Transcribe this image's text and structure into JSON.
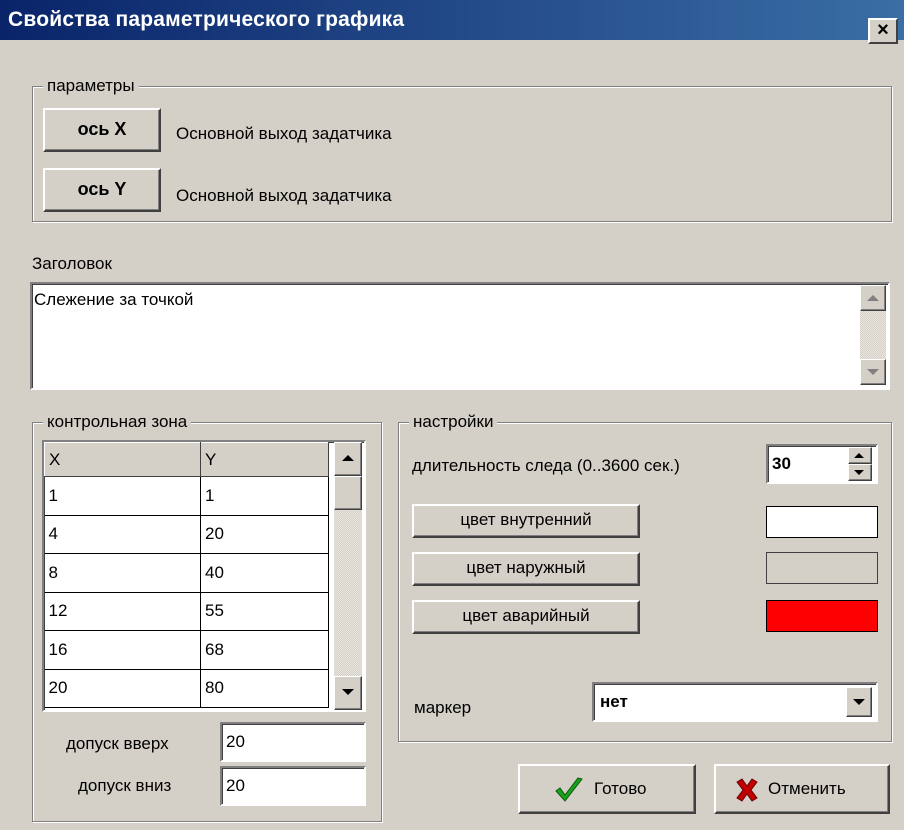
{
  "window": {
    "title": "Свойства параметрического графика",
    "close_label": "×"
  },
  "params": {
    "group_label": "параметры",
    "axis_x": {
      "button": "ось X",
      "source": "Основной выход задатчика"
    },
    "axis_y": {
      "button": "ось Y",
      "source": "Основной выход задатчика"
    }
  },
  "header": {
    "label": "Заголовок",
    "value": "Слежение за точкой"
  },
  "control_zone": {
    "group_label": "контрольная зона",
    "columns": [
      "X",
      "Y"
    ],
    "rows": [
      [
        "1",
        "1"
      ],
      [
        "4",
        "20"
      ],
      [
        "8",
        "40"
      ],
      [
        "12",
        "55"
      ],
      [
        "16",
        "68"
      ],
      [
        "20",
        "80"
      ]
    ],
    "tolerance_up": {
      "label": "допуск вверх",
      "value": "20"
    },
    "tolerance_down": {
      "label": "допуск вниз",
      "value": "20"
    }
  },
  "settings": {
    "group_label": "настройки",
    "trail": {
      "label": "длительность следа (0..3600 сек.)",
      "value": "30"
    },
    "inner_color": {
      "button": "цвет внутренний",
      "color": "#ffffff"
    },
    "outer_color": {
      "button": "цвет наружный",
      "color": "#d4d0c8"
    },
    "alarm_color": {
      "button": "цвет аварийный",
      "color": "#ff0000"
    },
    "marker": {
      "label": "маркер",
      "value": "нет"
    }
  },
  "actions": {
    "ok": "Готово",
    "cancel": "Отменить"
  },
  "colors": {
    "title_gradient_start": "#0a246a",
    "title_gradient_end": "#3a6ea5",
    "face": "#d4d0c8",
    "ok_check": "#1aa01a",
    "cancel_x": "#c00000"
  }
}
